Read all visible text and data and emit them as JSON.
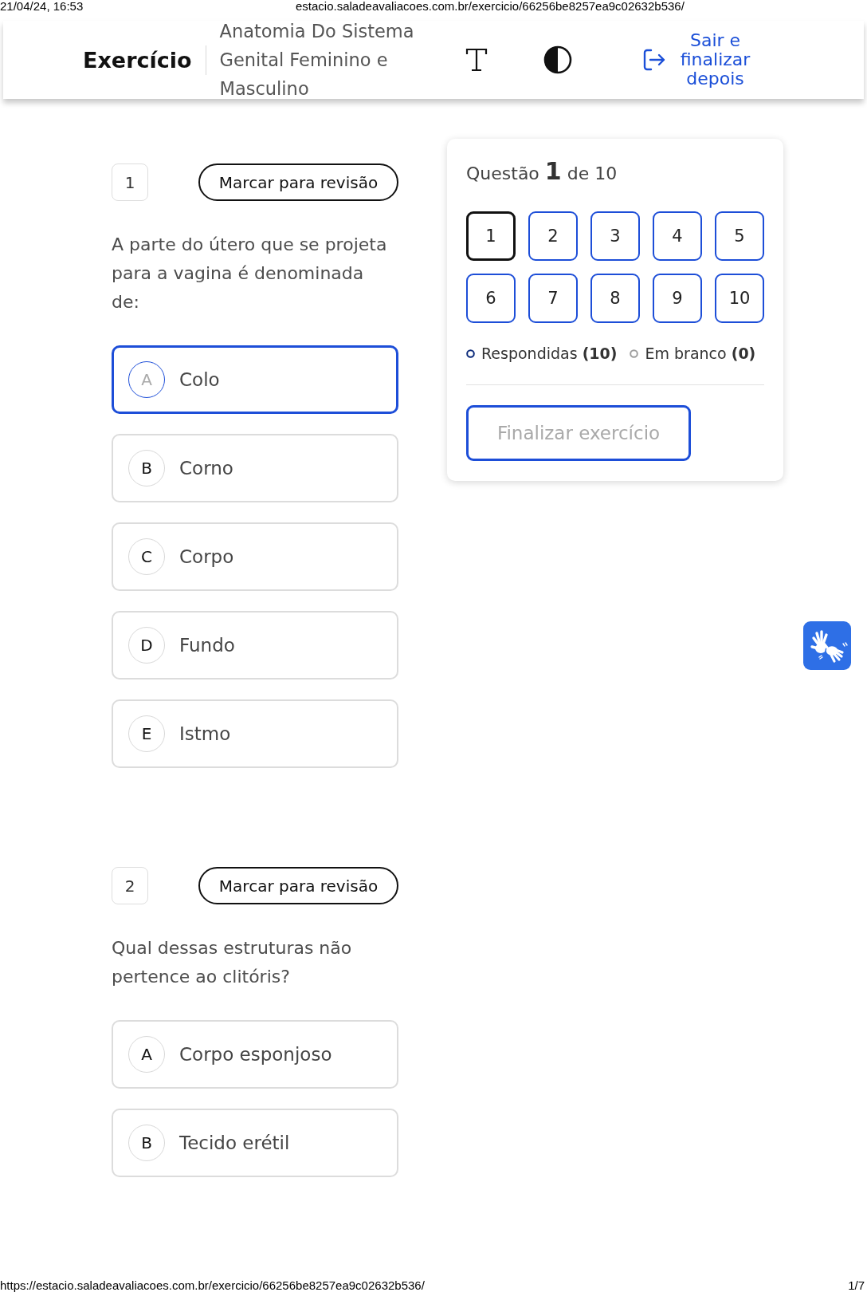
{
  "print_header": {
    "date": "21/04/24, 16:53",
    "url": "estacio.saladeavaliacoes.com.br/exercicio/66256be8257ea9c02632b536/"
  },
  "header": {
    "title": "Exercício",
    "subtitle": "Anatomia Do Sistema Genital Feminino e Masculino",
    "exit_label": "Sair e finalizar depois"
  },
  "questions": [
    {
      "number": "1",
      "review_label": "Marcar para revisão",
      "text": "A parte do útero que se projeta para a vagina é denominada de:",
      "options": [
        {
          "letter": "A",
          "text": "Colo",
          "selected": true
        },
        {
          "letter": "B",
          "text": "Corno",
          "selected": false
        },
        {
          "letter": "C",
          "text": "Corpo",
          "selected": false
        },
        {
          "letter": "D",
          "text": "Fundo",
          "selected": false
        },
        {
          "letter": "E",
          "text": "Istmo",
          "selected": false
        }
      ]
    },
    {
      "number": "2",
      "review_label": "Marcar para revisão",
      "text": "Qual dessas estruturas não pertence ao clitóris?",
      "options": [
        {
          "letter": "A",
          "text": "Corpo esponjoso",
          "selected": false
        },
        {
          "letter": "B",
          "text": "Tecido erétil",
          "selected": false
        }
      ]
    }
  ],
  "navigator": {
    "counter": "Questão **1** de 10",
    "questions": [
      {
        "label": "1",
        "selected": true
      },
      {
        "label": "2",
        "selected": false
      },
      {
        "label": "3",
        "selected": false
      },
      {
        "label": "4",
        "selected": false
      },
      {
        "label": "5",
        "selected": false
      },
      {
        "label": "6",
        "selected": false
      },
      {
        "label": "7",
        "selected": false
      },
      {
        "label": "8",
        "selected": false
      },
      {
        "label": "9",
        "selected": false
      },
      {
        "label": "10",
        "selected": false
      }
    ],
    "legend": [
      {
        "label": "Respondidas **(10)**",
        "color": "#0b2a7a"
      },
      {
        "label": "Em branco **(0)**",
        "color": "#9e9e9e"
      }
    ],
    "finish": {
      "label": "Finalizar exercício",
      "disabled": true
    }
  },
  "footer": {
    "url": "https://estacio.saladeavaliacoes.com.br/exercicio/66256be8257ea9c02632b536/",
    "page": "1/7"
  }
}
